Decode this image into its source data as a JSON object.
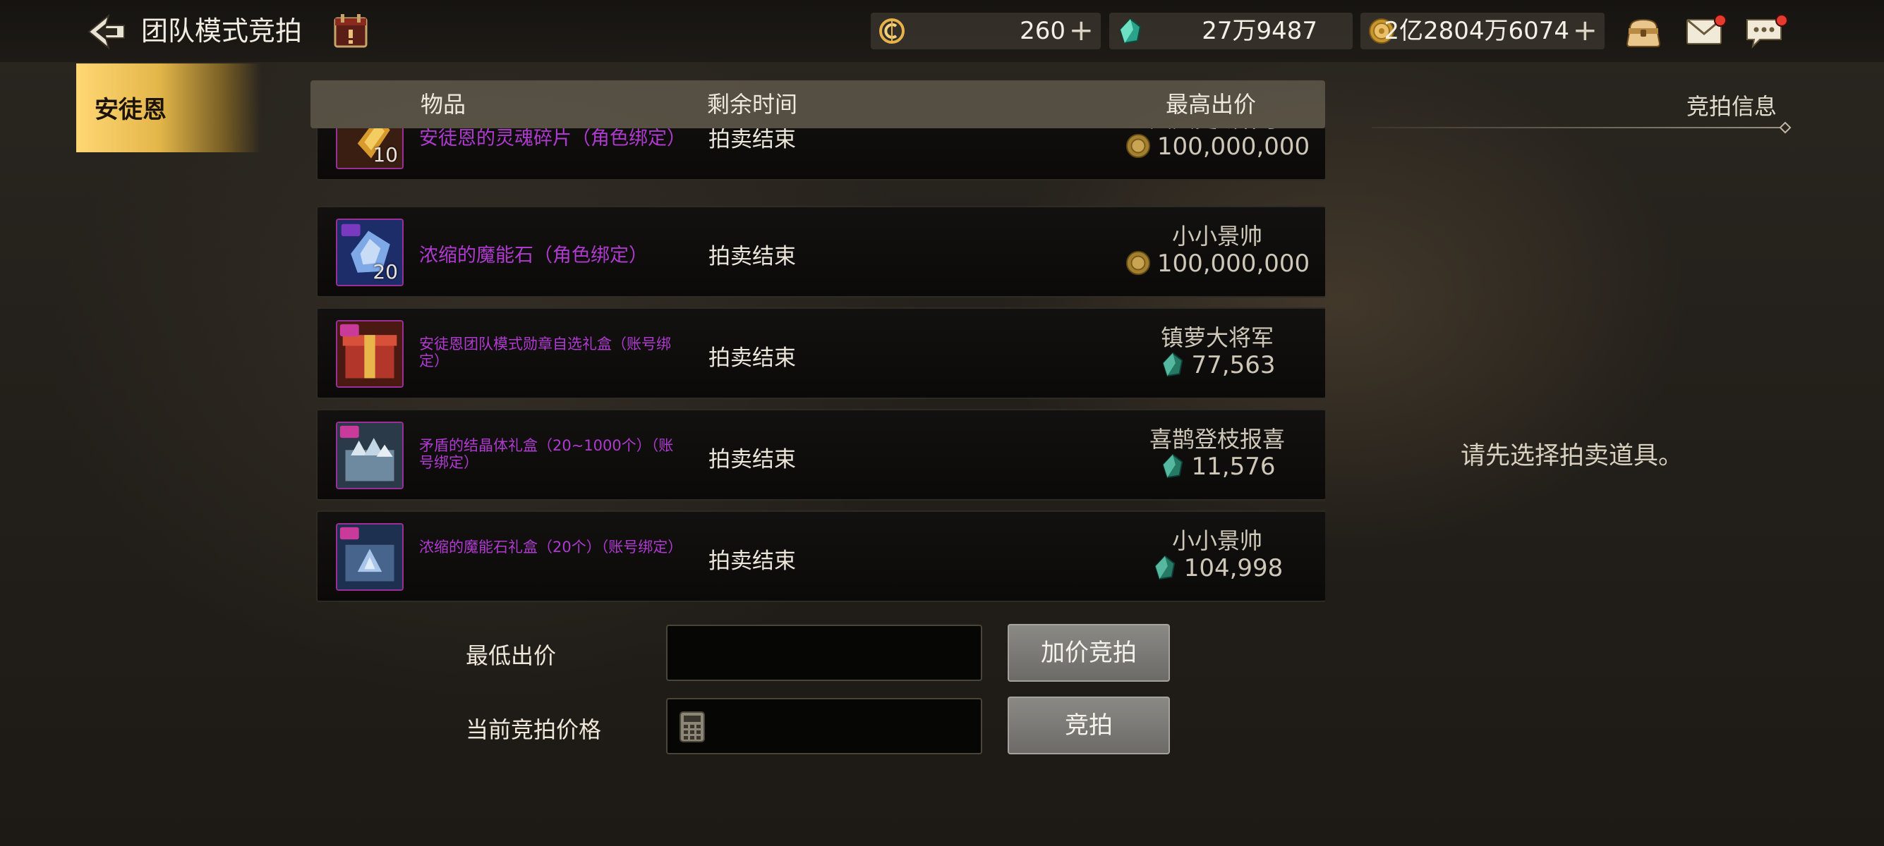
{
  "header": {
    "title": "团队模式竞拍",
    "resources": [
      {
        "icon": "credit-coin-icon",
        "value": "260"
      },
      {
        "icon": "gem-crystal-icon",
        "value": "27万9487"
      },
      {
        "icon": "gold-coin-icon",
        "value": "2亿2804万6074"
      }
    ],
    "plus_symbol": "+"
  },
  "character_tab": {
    "label": "安徒恩"
  },
  "list": {
    "headers": {
      "item": "物品",
      "time": "剩余时间",
      "highest_bid": "最高出价"
    },
    "rows": [
      {
        "name": "安徒恩的灵魂碎片（角色绑定）",
        "qty": "10",
        "time": "拍卖结束",
        "bidder": "天天更新补丁",
        "price": "100,000,000",
        "currency": "gold-coin-icon",
        "thumb": "soul-fragment-icon"
      },
      {
        "name": "浓缩的魔能石（角色绑定）",
        "qty": "20",
        "time": "拍卖结束",
        "bidder": "小小景帅",
        "price": "100,000,000",
        "currency": "gold-coin-icon",
        "thumb": "magic-stone-icon"
      },
      {
        "name": "安徒恩团队模式勋章自选礼盒（账号绑定）",
        "qty": "",
        "time": "拍卖结束",
        "bidder": "镇萝大将军",
        "price": "77,563",
        "currency": "gem-crystal-icon",
        "thumb": "medal-giftbox-icon"
      },
      {
        "name": "矛盾的结晶体礼盒（20~1000个）（账号绑定）",
        "qty": "",
        "time": "拍卖结束",
        "bidder": "喜鹊登枝报喜",
        "price": "11,576",
        "currency": "gem-crystal-icon",
        "thumb": "crystal-giftbox-icon"
      },
      {
        "name": "浓缩的魔能石礼盒（20个）（账号绑定）",
        "qty": "",
        "time": "拍卖结束",
        "bidder": "小小景帅",
        "price": "104,998",
        "currency": "gem-crystal-icon",
        "thumb": "magic-stone-giftbox-icon"
      }
    ]
  },
  "info_panel": {
    "title": "竞拍信息",
    "hint": "请先选择拍卖道具。"
  },
  "form": {
    "min_bid_label": "最低出价",
    "current_bid_label": "当前竞拍价格",
    "raise_button": "加价竞拍",
    "bid_button": "竞拍",
    "min_bid_value": "",
    "current_bid_value": ""
  },
  "colors": {
    "item_name": "#b03ad0",
    "tab_gold": "#e3b649",
    "button_gray": "#7a7975",
    "notification_dot": "#e53b2f"
  }
}
